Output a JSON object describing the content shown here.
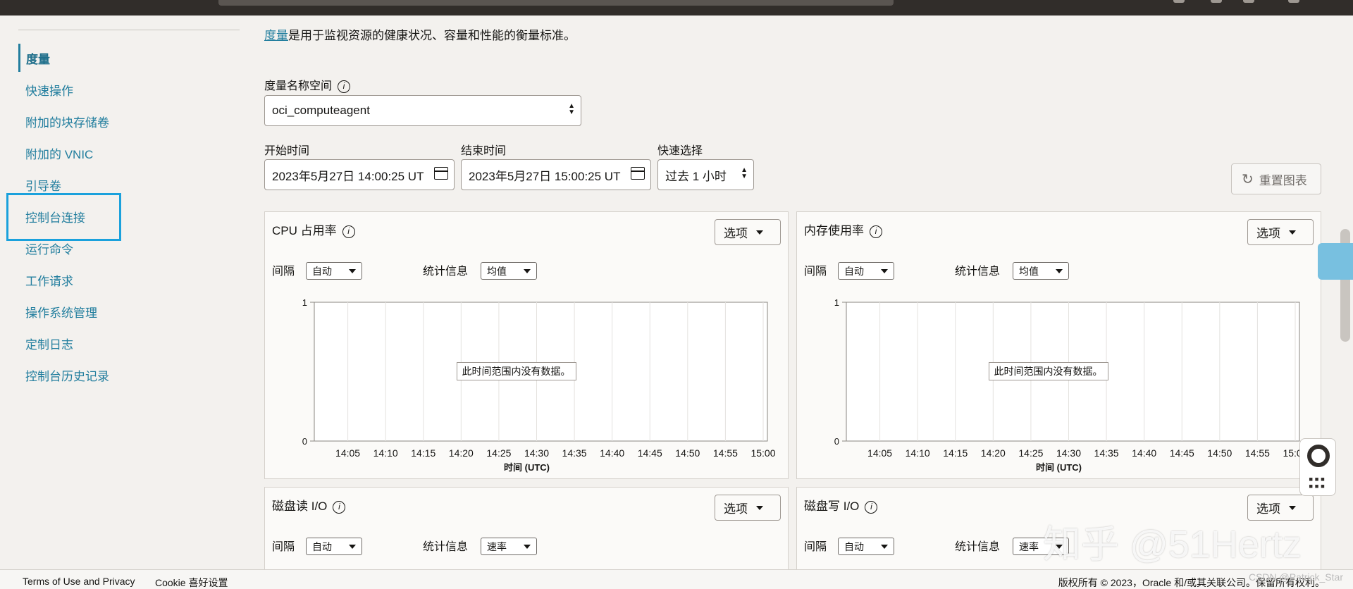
{
  "sidebar": {
    "items": [
      {
        "label": "度量",
        "active": true
      },
      {
        "label": "快速操作"
      },
      {
        "label": "附加的块存储卷"
      },
      {
        "label": "附加的 VNIC"
      },
      {
        "label": "引导卷"
      },
      {
        "label": "控制台连接"
      },
      {
        "label": "运行命令"
      },
      {
        "label": "工作请求"
      },
      {
        "label": "操作系统管理"
      },
      {
        "label": "定制日志"
      },
      {
        "label": "控制台历史记录"
      }
    ]
  },
  "intro": {
    "link": "度量",
    "text": "是用于监视资源的健康状况、容量和性能的衡量标准。"
  },
  "namespace": {
    "label": "度量名称空间",
    "value": "oci_computeagent"
  },
  "start": {
    "label": "开始时间",
    "value": "2023年5月27日 14:00:25 UT"
  },
  "end": {
    "label": "结束时间",
    "value": "2023年5月27日 15:00:25 UT"
  },
  "quick": {
    "label": "快速选择",
    "value": "过去 1 小时"
  },
  "reset_label": "重置图表",
  "panels": [
    {
      "title": "CPU 占用率",
      "options": "选项",
      "interval_label": "间隔",
      "interval": "自动",
      "stat_label": "统计信息",
      "stat": "均值",
      "nodata": "此时间范围内没有数据。",
      "xaxis": "时间 (UTC)"
    },
    {
      "title": "内存使用率",
      "options": "选项",
      "interval_label": "间隔",
      "interval": "自动",
      "stat_label": "统计信息",
      "stat": "均值",
      "nodata": "此时间范围内没有数据。",
      "xaxis": "时间 (UTC)"
    },
    {
      "title": "磁盘读 I/O",
      "options": "选项",
      "interval_label": "间隔",
      "interval": "自动",
      "stat_label": "统计信息",
      "stat": "速率"
    },
    {
      "title": "磁盘写 I/O",
      "options": "选项",
      "interval_label": "间隔",
      "interval": "自动",
      "stat_label": "统计信息",
      "stat": "速率"
    }
  ],
  "chart_data": [
    {
      "type": "line",
      "title": "CPU 占用率",
      "xlabel": "时间 (UTC)",
      "x": [
        "14:05",
        "14:10",
        "14:15",
        "14:20",
        "14:25",
        "14:30",
        "14:35",
        "14:40",
        "14:45",
        "14:50",
        "14:55",
        "15:00"
      ],
      "yticks": [
        "1",
        "0"
      ],
      "ylim": [
        0,
        1
      ],
      "series": [],
      "annotation": "此时间范围内没有数据。"
    },
    {
      "type": "line",
      "title": "内存使用率",
      "xlabel": "时间 (UTC)",
      "x": [
        "14:05",
        "14:10",
        "14:15",
        "14:20",
        "14:25",
        "14:30",
        "14:35",
        "14:40",
        "14:45",
        "14:50",
        "14:55",
        "15:00"
      ],
      "yticks": [
        "1",
        "0"
      ],
      "ylim": [
        0,
        1
      ],
      "series": [],
      "annotation": "此时间范围内没有数据。"
    }
  ],
  "footer": {
    "terms": "Terms of Use and Privacy",
    "cookie": "Cookie 喜好设置",
    "copyright": "版权所有 © 2023，Oracle 和/或其关联公司。保留所有权利。",
    "csdn": "CSDN @Patrick_Star"
  },
  "watermark": "知乎 @51Hertz"
}
